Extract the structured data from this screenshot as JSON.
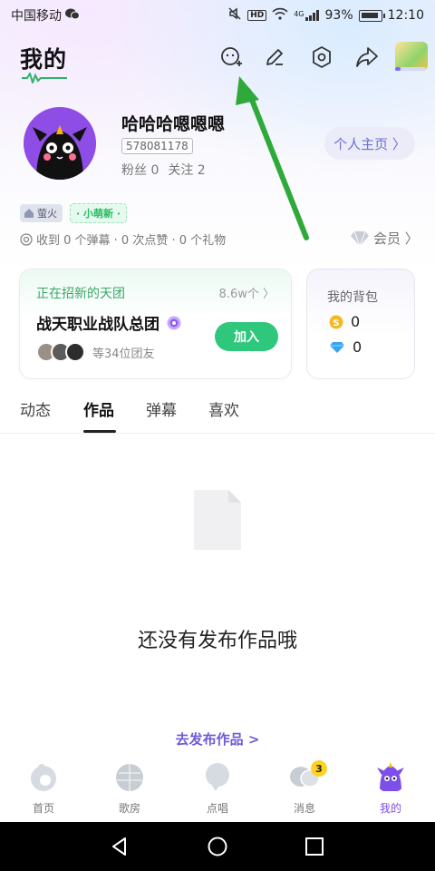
{
  "status_bar": {
    "carrier": "中国移动",
    "hd": "HD",
    "network": "4G",
    "battery": "93%",
    "time": "12:10"
  },
  "header": {
    "title": "我的"
  },
  "profile": {
    "nickname": "哈哈哈嗯嗯嗯",
    "uid": "578081178",
    "fans": "粉丝 0",
    "follow": "关注 2",
    "profile_button": "个人主页 〉",
    "level_tag": "萤火",
    "new_tag": "· 小萌新 ·",
    "received": "收到 0 个弹幕 · 0 次点赞 · 0 个礼物",
    "vip": "会员 〉"
  },
  "team_card": {
    "recruit_label": "正在招新的天团",
    "count": "8.6w个 〉",
    "team_name": "战天职业战队总团",
    "members_text": "等34位团友",
    "join_label": "加入"
  },
  "bag_card": {
    "title": "我的背包",
    "coins": "0",
    "diamonds": "0"
  },
  "tabs": [
    {
      "label": "动态"
    },
    {
      "label": "作品"
    },
    {
      "label": "弹幕"
    },
    {
      "label": "喜欢"
    }
  ],
  "empty_state": {
    "text": "还没有发布作品哦",
    "publish_link": "去发布作品 >"
  },
  "bottom_nav": [
    {
      "label": "首页"
    },
    {
      "label": "歌房"
    },
    {
      "label": "点唱"
    },
    {
      "label": "消息",
      "badge": "3"
    },
    {
      "label": "我的"
    }
  ],
  "colors": {
    "accent_purple": "#7e4ee8",
    "join_green": "#2ec77c",
    "annotation_arrow": "#2faa3a"
  }
}
